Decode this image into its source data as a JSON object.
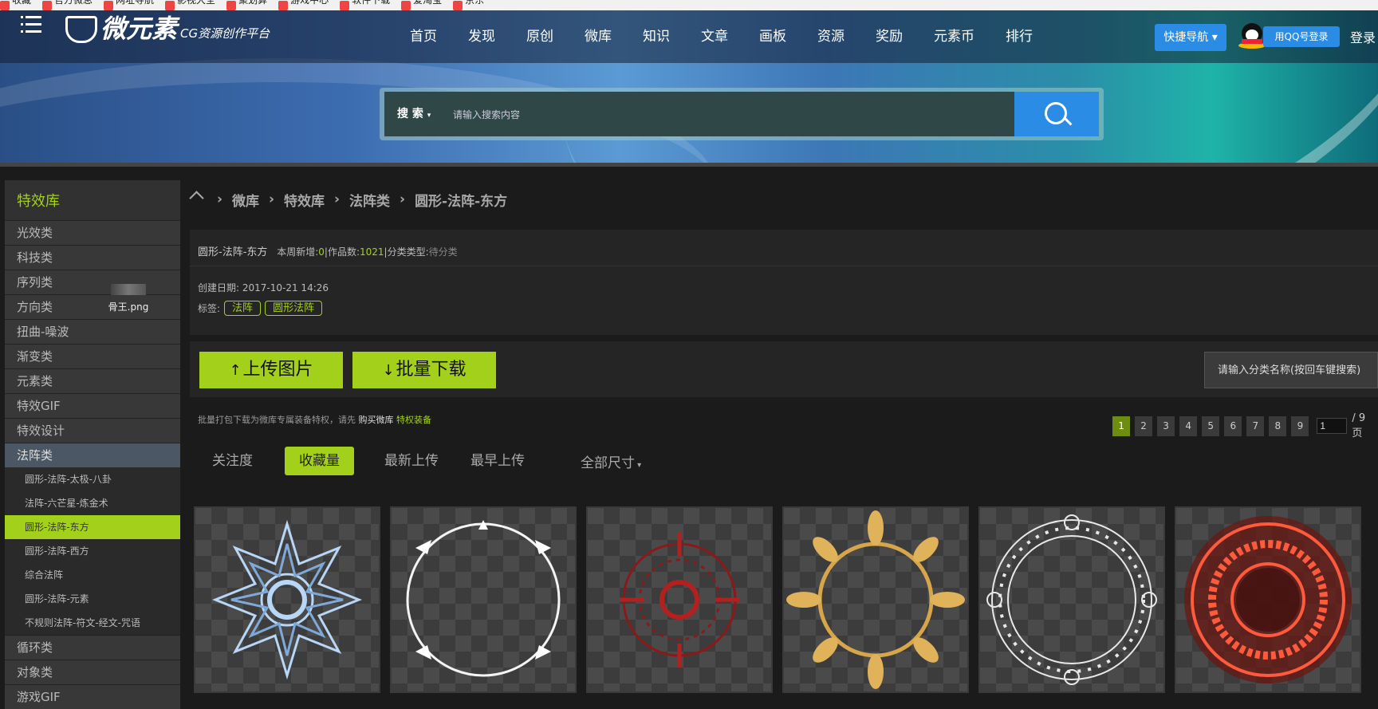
{
  "bookmarks": [
    "收藏",
    "官方微息",
    "网址导航",
    "影视大全",
    "聚划算",
    "游戏中心",
    "软件下载",
    "爱淘宝",
    "京东"
  ],
  "header": {
    "logo_name": "微元素",
    "logo_sub": "CG资源创作平台",
    "nav": [
      "首页",
      "发现",
      "原创",
      "微库",
      "知识",
      "文章",
      "画板",
      "资源",
      "奖励",
      "元素币",
      "排行"
    ],
    "quick_nav": "快捷导航",
    "qq_login": "用QQ号登录",
    "login": "登录"
  },
  "search": {
    "type_label": "搜 索",
    "placeholder": "请输入搜索内容"
  },
  "sidebar": {
    "title": "特效库",
    "items": [
      "光效类",
      "科技类",
      "序列类",
      "方向类",
      "扭曲-噪波",
      "渐变类",
      "元素类",
      "特效GIF",
      "特效设计",
      "法阵类"
    ],
    "sub_items": [
      "圆形-法阵-太极-八卦",
      "法阵-六芒星-炼金术",
      "圆形-法阵-东方",
      "圆形-法阵-西方",
      "综合法阵",
      "圆形-法阵-元素",
      "不规则法阵-符文-经文-咒语"
    ],
    "items_after": [
      "循环类",
      "对象类",
      "游戏GIF"
    ]
  },
  "desktop_icon": {
    "label": "骨王.png"
  },
  "breadcrumb": [
    "微库",
    "特效库",
    "法阵类",
    "圆形-法阵-东方"
  ],
  "info": {
    "name": "圆形-法阵-东方",
    "weekly_label": "本周新增:",
    "weekly_value": "0",
    "works_label": "|作品数:",
    "works_value": "1021",
    "category_label": "|分类类型:",
    "category_value": "待分类",
    "created_label": "创建日期:",
    "created_value": "2017-10-21 14:26",
    "tags_label": "标签:",
    "tags": [
      "法阵",
      "圆形法阵"
    ]
  },
  "actions": {
    "upload": "上传图片",
    "download": "批量下载",
    "category_search": "请输入分类名称(按回车键搜索)"
  },
  "notice": {
    "text": "批量打包下载为微库专属装备特权，请先",
    "buy": "购买微库",
    "privilege": "特权装备"
  },
  "pagination": {
    "pages": [
      "1",
      "2",
      "3",
      "4",
      "5",
      "6",
      "7",
      "8",
      "9"
    ],
    "current": "1",
    "input_value": "1",
    "total": "/ 9 页"
  },
  "sort_tabs": [
    "关注度",
    "收藏量",
    "最新上传",
    "最早上传"
  ],
  "size_select": "全部尺寸",
  "colors": {
    "accent_green": "#a3d11b",
    "blue": "#2b8ce6",
    "bg": "#1b1b1b"
  },
  "thumbnails": [
    "blue-mandala-icon",
    "white-thorn-ring-icon",
    "red-rune-circle-icon",
    "golden-flower-ring-icon",
    "white-rune-circle-icon",
    "red-glow-seal-icon"
  ]
}
